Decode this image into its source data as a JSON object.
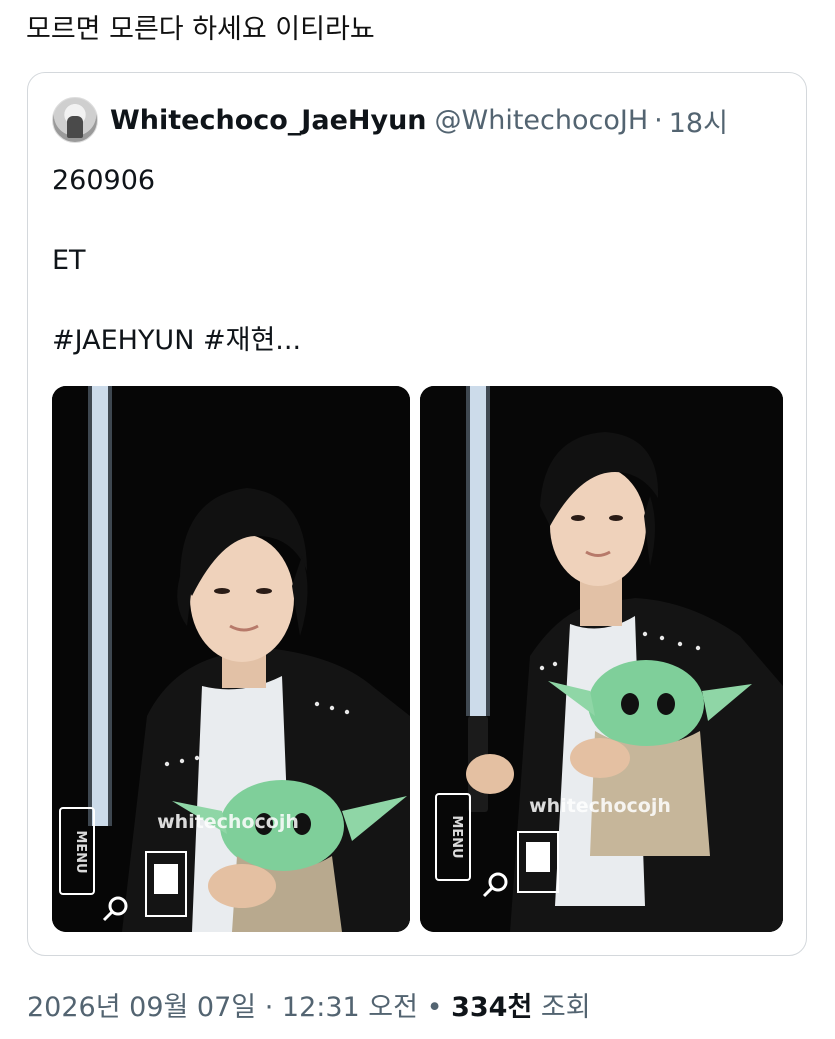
{
  "post": {
    "text": "모르면 모른다 하세요 이티라뇨"
  },
  "quoted_tweet": {
    "display_name": "Whitechoco_JaeHyun",
    "handle": "@WhitechocoJH",
    "separator": "·",
    "time": "18시",
    "body_lines": [
      "260906",
      "",
      "ET",
      "",
      "#JAEHYUN #재현..."
    ],
    "photos": [
      {
        "watermark": "whitechocojh",
        "overlay_label": "MENU"
      },
      {
        "watermark": "whitechocojh",
        "overlay_label": "MENU"
      }
    ]
  },
  "footer": {
    "date": "2026년 09월 07일",
    "sep1": "·",
    "time": "12:31 오전",
    "sep2": "•",
    "views_count": "334천",
    "views_label": "조회"
  }
}
